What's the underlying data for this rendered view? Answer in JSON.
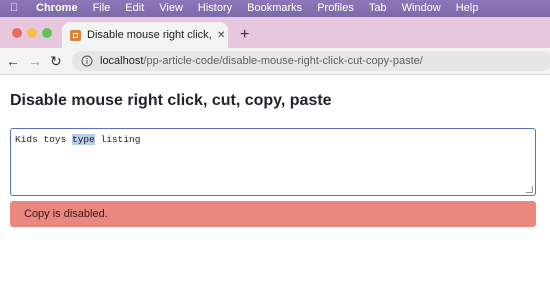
{
  "menubar": {
    "apple_icon": "apple-icon",
    "items": [
      "Chrome",
      "File",
      "Edit",
      "View",
      "History",
      "Bookmarks",
      "Profiles",
      "Tab",
      "Window",
      "Help"
    ]
  },
  "tab": {
    "title": "Disable mouse right click, cut,",
    "close": "✕",
    "favicon": "favicon-icon"
  },
  "newtab": "+",
  "toolbar": {
    "back": "←",
    "forward": "→",
    "reload": "↻",
    "url_host": "localhost",
    "url_path": "/pp-article-code/disable-mouse-right-click-cut-copy-paste/"
  },
  "page": {
    "title": "Disable mouse right click, cut, copy, paste",
    "textarea": {
      "before": "Kids toys ",
      "selected": "type",
      "after": " listing"
    },
    "alert": "Copy is disabled."
  },
  "colors": {
    "menubar": "#8471b0",
    "tabstrip": "#e6c7de",
    "alert_bg": "#ea877f",
    "textarea_border": "#5a6fbf",
    "selection": "#b6cdea"
  }
}
